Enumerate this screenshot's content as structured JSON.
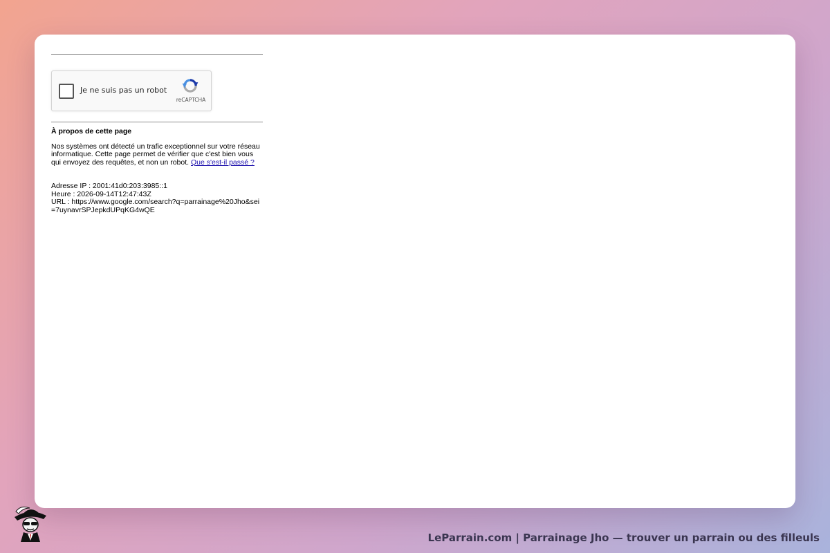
{
  "captcha": {
    "checkbox_label": "Je ne suis pas un robot",
    "brand": "reCAPTCHA"
  },
  "about": {
    "title": "À propos de cette page",
    "text": "Nos systèmes ont détecté un trafic exceptionnel sur votre réseau informatique. Cette page permet de vérifier que c'est bien vous qui envoyez des requêtes, et non un robot.",
    "link_text": "Que s'est-il passé ?"
  },
  "info": {
    "ip": "Adresse IP : 2001:41d0:203:3985::1",
    "time": "Heure : 2026-09-14T12:47:43Z",
    "url": "URL : https://www.google.com/search?q=parrainage%20Jho&sei=7uynavrSPJepkdUPqKG4wQE"
  },
  "footer": {
    "caption": "LeParrain.com | Parrainage Jho — trouver un parrain ou des filleuls"
  },
  "colors": {
    "link": "#1a0dab",
    "recaptcha_blue": "#1c3aa9",
    "recaptcha_light_blue": "#4a90e2",
    "recaptcha_gray": "#ababab"
  }
}
